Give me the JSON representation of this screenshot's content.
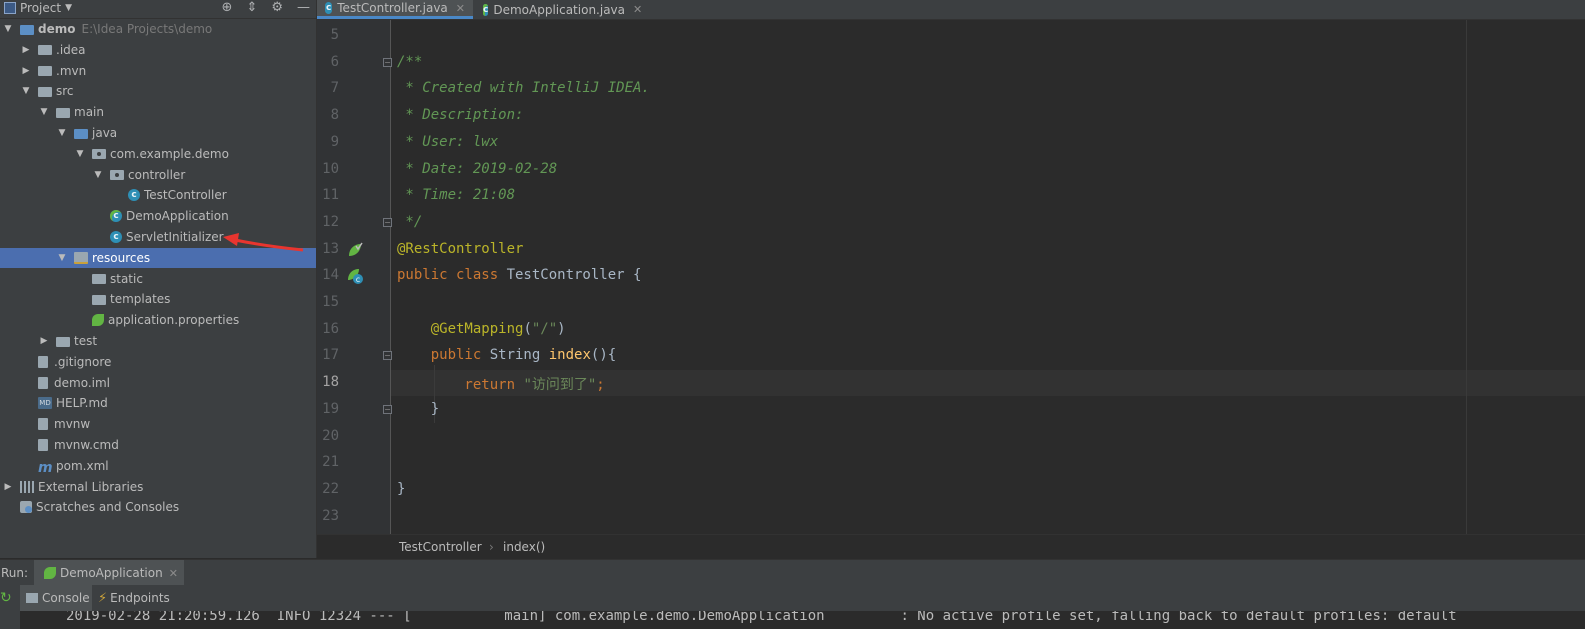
{
  "project_panel": {
    "title": "Project",
    "tree": [
      {
        "label": "demo",
        "path": "E:\\Idea Projects\\demo",
        "icon": "module-folder-icon",
        "arrow": "▼",
        "level": 0,
        "bold": true
      },
      {
        "label": ".idea",
        "icon": "folder-icon",
        "arrow": "▶",
        "level": 1
      },
      {
        "label": ".mvn",
        "icon": "folder-icon",
        "arrow": "▶",
        "level": 1
      },
      {
        "label": "src",
        "icon": "folder-icon",
        "arrow": "▼",
        "level": 1
      },
      {
        "label": "main",
        "icon": "folder-icon",
        "arrow": "▼",
        "level": 2
      },
      {
        "label": "java",
        "icon": "source-folder-icon",
        "arrow": "▼",
        "level": 3
      },
      {
        "label": "com.example.demo",
        "icon": "package-icon",
        "arrow": "▼",
        "level": 4
      },
      {
        "label": "controller",
        "icon": "package-icon",
        "arrow": "▼",
        "level": 5
      },
      {
        "label": "TestController",
        "icon": "class-icon",
        "arrow": "",
        "level": 6
      },
      {
        "label": "DemoApplication",
        "icon": "spring-boot-class-icon",
        "arrow": "",
        "level": 5
      },
      {
        "label": "ServletInitializer",
        "icon": "class-icon",
        "arrow": "",
        "level": 5
      },
      {
        "label": "resources",
        "icon": "resources-folder-icon",
        "arrow": "▼",
        "level": 3,
        "selected": true
      },
      {
        "label": "static",
        "icon": "folder-icon",
        "arrow": "",
        "level": 4
      },
      {
        "label": "templates",
        "icon": "folder-icon",
        "arrow": "",
        "level": 4
      },
      {
        "label": "application.properties",
        "icon": "spring-properties-icon",
        "arrow": "",
        "level": 4
      },
      {
        "label": "test",
        "icon": "folder-icon",
        "arrow": "▶",
        "level": 2
      },
      {
        "label": ".gitignore",
        "icon": "file-icon",
        "arrow": "",
        "level": 1
      },
      {
        "label": "demo.iml",
        "icon": "file-icon",
        "arrow": "",
        "level": 1
      },
      {
        "label": "HELP.md",
        "icon": "markdown-icon",
        "arrow": "",
        "level": 1
      },
      {
        "label": "mvnw",
        "icon": "file-icon",
        "arrow": "",
        "level": 1
      },
      {
        "label": "mvnw.cmd",
        "icon": "file-icon",
        "arrow": "",
        "level": 1
      },
      {
        "label": "pom.xml",
        "icon": "maven-icon",
        "arrow": "",
        "level": 1
      },
      {
        "label": "External Libraries",
        "icon": "libraries-icon",
        "arrow": "▶",
        "level": 0
      },
      {
        "label": "Scratches and Consoles",
        "icon": "scratches-icon",
        "arrow": "",
        "level": 0
      }
    ]
  },
  "editor_tabs": [
    {
      "label": "TestController.java",
      "active": true
    },
    {
      "label": "DemoApplication.java",
      "active": false
    }
  ],
  "editor": {
    "current_line": "18",
    "lines": [
      {
        "n": "5",
        "tokens": []
      },
      {
        "n": "6",
        "tokens": [
          {
            "t": "/**",
            "c": "cm"
          }
        ]
      },
      {
        "n": "7",
        "tokens": [
          {
            "t": " * Created with IntelliJ IDEA.",
            "c": "cm"
          }
        ]
      },
      {
        "n": "8",
        "tokens": [
          {
            "t": " * Description:",
            "c": "cm"
          }
        ]
      },
      {
        "n": "9",
        "tokens": [
          {
            "t": " * User: lwx",
            "c": "cm"
          }
        ]
      },
      {
        "n": "10",
        "tokens": [
          {
            "t": " * Date: 2019-02-28",
            "c": "cm"
          }
        ]
      },
      {
        "n": "11",
        "tokens": [
          {
            "t": " * Time: 21:08",
            "c": "cm"
          }
        ]
      },
      {
        "n": "12",
        "tokens": [
          {
            "t": " */",
            "c": "cm"
          }
        ]
      },
      {
        "n": "13",
        "tokens": [
          {
            "t": "@RestController",
            "c": "ann"
          }
        ]
      },
      {
        "n": "14",
        "tokens": [
          {
            "t": "public class ",
            "c": "kw"
          },
          {
            "t": "TestController {",
            "c": "pl"
          }
        ]
      },
      {
        "n": "15",
        "tokens": []
      },
      {
        "n": "16",
        "tokens": [
          {
            "t": "    @GetMapping",
            "c": "ann"
          },
          {
            "t": "(",
            "c": "pl"
          },
          {
            "t": "\"/\"",
            "c": "str"
          },
          {
            "t": ")",
            "c": "pl"
          }
        ]
      },
      {
        "n": "17",
        "tokens": [
          {
            "t": "    public ",
            "c": "kw"
          },
          {
            "t": "String ",
            "c": "pl"
          },
          {
            "t": "index",
            "c": "fn"
          },
          {
            "t": "(){",
            "c": "pl"
          }
        ]
      },
      {
        "n": "18",
        "tokens": [
          {
            "t": "        return ",
            "c": "kw"
          },
          {
            "t": "\"访问到了\"",
            "c": "str"
          },
          {
            "t": ";",
            "c": "kw"
          }
        ]
      },
      {
        "n": "19",
        "tokens": [
          {
            "t": "    }",
            "c": "pl"
          }
        ]
      },
      {
        "n": "20",
        "tokens": []
      },
      {
        "n": "21",
        "tokens": []
      },
      {
        "n": "22",
        "tokens": [
          {
            "t": "}",
            "c": "pl"
          }
        ]
      },
      {
        "n": "23",
        "tokens": []
      }
    ]
  },
  "breadcrumb": {
    "items": [
      "TestController",
      "index()"
    ],
    "separator": "›"
  },
  "run_panel": {
    "label": "Run:",
    "config_tab": "DemoApplication",
    "tabs": [
      "Console",
      "Endpoints"
    ],
    "console_line": "2019-02-28 21:20:59.126  INFO 12324 --- [           main] com.example.demo.DemoApplication         : No active profile set, falling back to default profiles: default"
  },
  "colors": {
    "selection": "#4b6eaf",
    "editor_bg": "#2b2b2b",
    "panel_bg": "#3c3f41",
    "comment": "#629755",
    "annotation": "#bbb529",
    "keyword": "#cc7832",
    "string": "#6a8759",
    "annotation_arrow": "#e8352f"
  }
}
